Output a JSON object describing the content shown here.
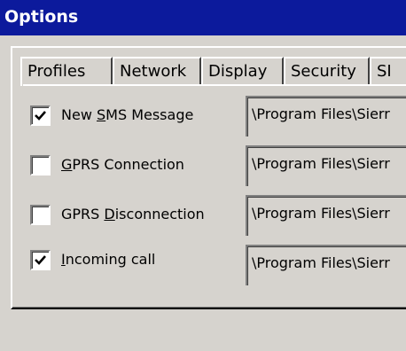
{
  "window": {
    "title": "Options"
  },
  "tabs": [
    {
      "label": "Profiles"
    },
    {
      "label": "Network"
    },
    {
      "label": "Display"
    },
    {
      "label": "Security"
    },
    {
      "label": "SI"
    }
  ],
  "events": [
    {
      "label_pre": "New ",
      "label_key": "S",
      "label_post": "MS Message",
      "checked": true,
      "path": "\\Program Files\\Sierr"
    },
    {
      "label_pre": "",
      "label_key": "G",
      "label_post": "PRS Connection",
      "checked": false,
      "path": "\\Program Files\\Sierr"
    },
    {
      "label_pre": "GPRS ",
      "label_key": "D",
      "label_post": "isconnection",
      "checked": false,
      "path": "\\Program Files\\Sierr"
    },
    {
      "label_pre": "",
      "label_key": "I",
      "label_post": "ncoming call",
      "checked": true,
      "path": "\\Program Files\\Sierr"
    }
  ]
}
